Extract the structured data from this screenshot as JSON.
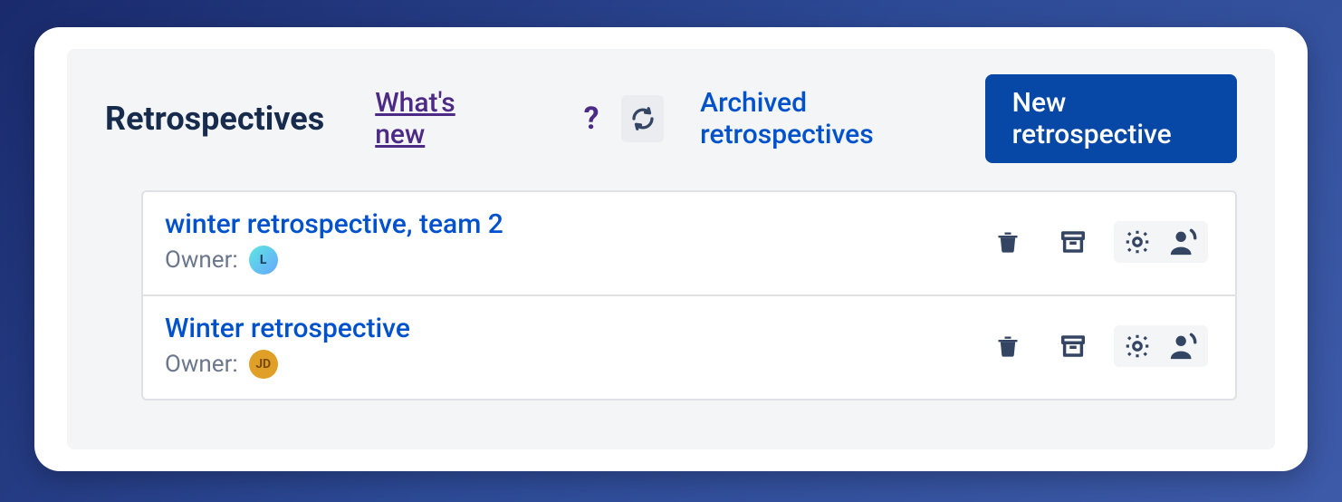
{
  "header": {
    "title": "Retrospectives",
    "whats_new": "What's new",
    "archived": "Archived retrospectives",
    "new_btn": "New retrospective"
  },
  "list": {
    "owner_label": "Owner:",
    "items": [
      {
        "title": "winter retrospective, team 2",
        "avatar": "L",
        "avatar_class": "teal"
      },
      {
        "title": "Winter retrospective",
        "avatar": "JD",
        "avatar_class": "orange"
      }
    ]
  }
}
